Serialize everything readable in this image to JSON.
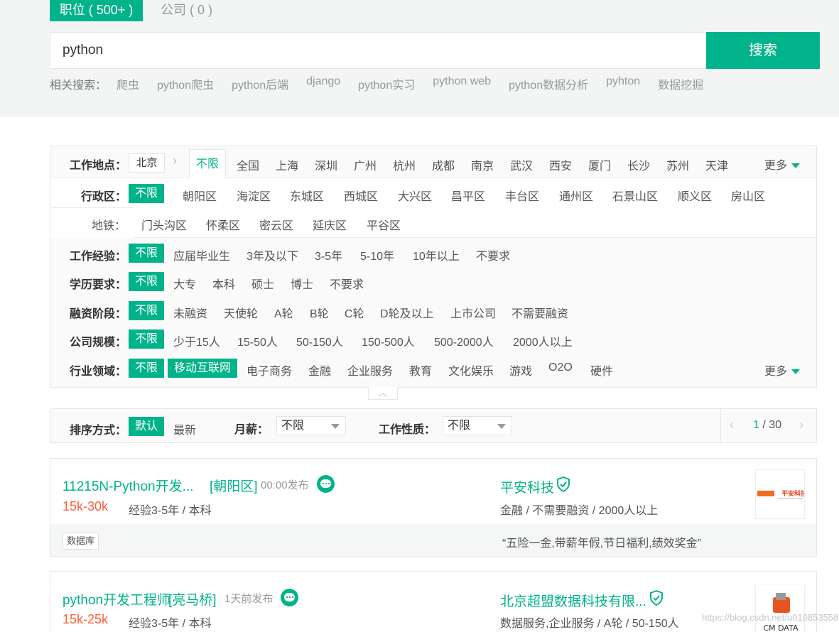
{
  "tabs": {
    "jobs": "职位 ( 500+ )",
    "companies": "公司 ( 0 )"
  },
  "search": {
    "value": "python",
    "button": "搜索"
  },
  "related": {
    "label": "相关搜索：",
    "items": [
      "爬虫",
      "python爬虫",
      "python后端",
      "django",
      "python实习",
      "python web",
      "python数据分析",
      "pyhton",
      "数据挖掘"
    ]
  },
  "filters": {
    "location_label": "工作地点：",
    "current_city": "北京",
    "city_unlimited": "不限",
    "cities": [
      "全国",
      "上海",
      "深圳",
      "广州",
      "杭州",
      "成都",
      "南京",
      "武汉",
      "西安",
      "厦门",
      "长沙",
      "苏州",
      "天津"
    ],
    "more": "更多",
    "district_label": "行政区：",
    "district_active": "不限",
    "districts_row1": [
      "朝阳区",
      "海淀区",
      "东城区",
      "西城区",
      "大兴区",
      "昌平区",
      "丰台区",
      "通州区",
      "石景山区",
      "顺义区",
      "房山区"
    ],
    "subway_label": "地铁：",
    "districts_row2": [
      "门头沟区",
      "怀柔区",
      "密云区",
      "延庆区",
      "平谷区"
    ],
    "experience_label": "工作经验：",
    "experience_active": "不限",
    "experience": [
      "应届毕业生",
      "3年及以下",
      "3-5年",
      "5-10年",
      "10年以上",
      "不要求"
    ],
    "education_label": "学历要求：",
    "education_active": "不限",
    "education": [
      "大专",
      "本科",
      "硕士",
      "博士",
      "不要求"
    ],
    "funding_label": "融资阶段：",
    "funding_active": "不限",
    "funding": [
      "未融资",
      "天使轮",
      "A轮",
      "B轮",
      "C轮",
      "D轮及以上",
      "上市公司",
      "不需要融资"
    ],
    "size_label": "公司规模：",
    "size_active": "不限",
    "size": [
      "少于15人",
      "15-50人",
      "50-150人",
      "150-500人",
      "500-2000人",
      "2000人以上"
    ],
    "industry_label": "行业领域：",
    "industry_active": "不限",
    "industry_active2": "移动互联网",
    "industry": [
      "电子商务",
      "金融",
      "企业服务",
      "教育",
      "文化娱乐",
      "游戏",
      "O2O",
      "硬件"
    ],
    "industry_more": "更多"
  },
  "sort": {
    "label": "排序方式：",
    "active": "默认",
    "latest": "最新",
    "salary_label": "月薪：",
    "salary_value": "不限",
    "nature_label": "工作性质：",
    "nature_value": "不限",
    "page_current": "1",
    "page_total": "/ 30"
  },
  "jobs": [
    {
      "title": "11215N-Python开发...",
      "location": "[朝阳区]",
      "published": "00:00发布",
      "salary": "15k-30k",
      "requirement": "经验3-5年 / 本科",
      "company": "平安科技",
      "industry": "金融 / 不需要融资 / 2000人以上",
      "tag": "数据库",
      "perk": "“五险一金,带薪年假,节日福利,绩效奖金”",
      "logo_text": "平安科技"
    },
    {
      "title": "python开发工程师",
      "location": "[亮马桥]",
      "published": "1天前发布",
      "salary": "15k-25k",
      "requirement": "经验3-5年 / 本科",
      "company": "北京超盟数据科技有限...",
      "industry": "数据服务,企业服务 / A轮 / 50-150人",
      "logo_text": "CM DATA"
    }
  ],
  "watermark": "https://blog.csdn.net/u010853558",
  "colors": {
    "accent": "#00b38a",
    "salary": "#fd5f39"
  }
}
